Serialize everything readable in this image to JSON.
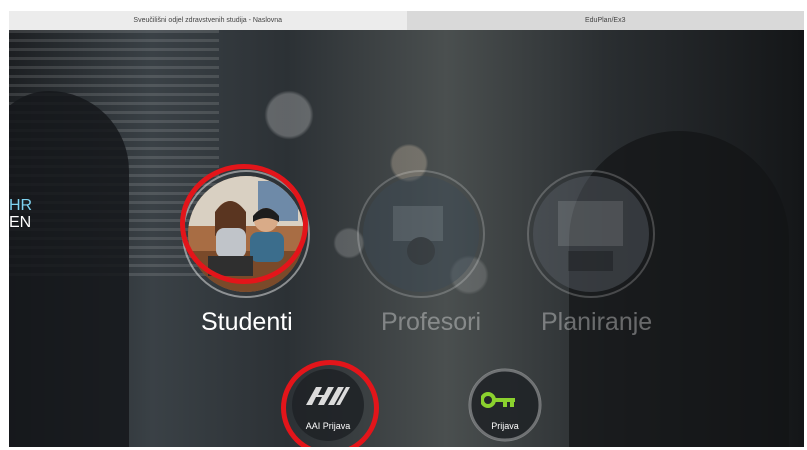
{
  "tabs": [
    {
      "label": "Sveučilišni odjel zdravstvenih studija - Naslovna"
    },
    {
      "label": "EduPlan/Ex3"
    }
  ],
  "language": {
    "hr": "HR",
    "en": "EN"
  },
  "portals": [
    {
      "label": "Studenti"
    },
    {
      "label": "Profesori"
    },
    {
      "label": "Planiranje"
    }
  ],
  "login": {
    "aai_label": "AAI Prijava",
    "aai_logo_text": "AAI",
    "prijava_label": "Prijava"
  },
  "colors": {
    "highlight": "#e3151a",
    "key_green": "#8bd12e",
    "lang_active": "#7fd3f0"
  },
  "icons": {
    "aai": "aai-logo-icon",
    "key": "key-icon"
  }
}
